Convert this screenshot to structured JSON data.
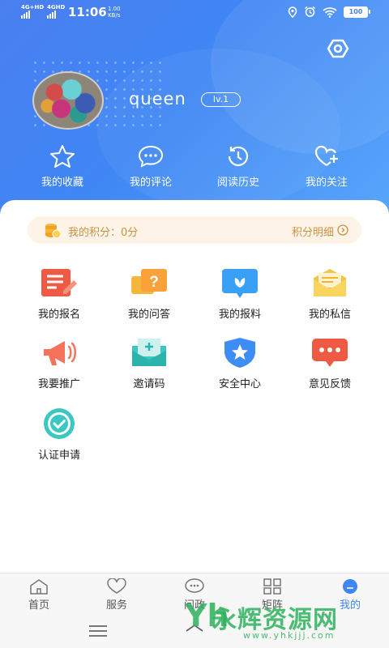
{
  "status_bar": {
    "net1": "4G+HD",
    "net2": "4GHD",
    "time": "11:06",
    "speed_value": "1.00",
    "speed_unit": "KB/s",
    "battery": "100"
  },
  "profile": {
    "username": "queen",
    "level": "lv.1"
  },
  "quick_actions": [
    {
      "label": "我的收藏",
      "icon": "star-icon"
    },
    {
      "label": "我的评论",
      "icon": "comment-icon"
    },
    {
      "label": "阅读历史",
      "icon": "history-icon"
    },
    {
      "label": "我的关注",
      "icon": "heart-plus-icon"
    }
  ],
  "points": {
    "label": "我的积分：0分",
    "detail": "积分明细"
  },
  "services": [
    {
      "label": "我的报名",
      "icon": "sign-up-icon"
    },
    {
      "label": "我的问答",
      "icon": "qa-icon"
    },
    {
      "label": "我的报料",
      "icon": "report-icon"
    },
    {
      "label": "我的私信",
      "icon": "mail-icon"
    },
    {
      "label": "我要推广",
      "icon": "megaphone-icon"
    },
    {
      "label": "邀请码",
      "icon": "invite-code-icon"
    },
    {
      "label": "安全中心",
      "icon": "shield-icon"
    },
    {
      "label": "意见反馈",
      "icon": "feedback-icon"
    },
    {
      "label": "认证申请",
      "icon": "verify-badge-icon"
    }
  ],
  "tabbar": [
    {
      "label": "首页",
      "icon": "home-icon"
    },
    {
      "label": "服务",
      "icon": "service-icon"
    },
    {
      "label": "问政",
      "icon": "inquiry-icon"
    },
    {
      "label": "矩阵",
      "icon": "matrix-icon"
    },
    {
      "label": "我的",
      "icon": "me-icon"
    }
  ],
  "watermark": {
    "logo": "Yh",
    "text": "永辉资源网",
    "url": "www.yhkjjj.com"
  },
  "colors": {
    "primary": "#3f86f4",
    "points_text": "#c99241",
    "points_bg": "#fdf3e6"
  }
}
